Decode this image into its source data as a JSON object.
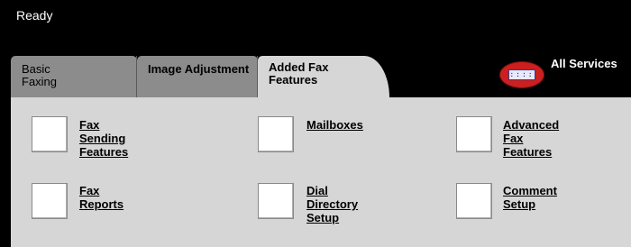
{
  "status_bar": {
    "text": "Ready"
  },
  "tabs": [
    {
      "label": "Basic\nFaxing",
      "active": false
    },
    {
      "label": "Image Adjustment",
      "active": false
    },
    {
      "label": "Added Fax\nFeatures",
      "active": true
    }
  ],
  "all_services": {
    "label": "All Services",
    "icon": "all-services-icon",
    "icon_glyphs": "::::"
  },
  "features": [
    {
      "label": "Fax Sending Features"
    },
    {
      "label": "Mailboxes"
    },
    {
      "label": "Advanced Fax \nFeatures"
    },
    {
      "label": "Fax Reports"
    },
    {
      "label": "Dial Directory Setup"
    },
    {
      "label": "Comment Setup"
    }
  ],
  "colors": {
    "background": "#000000",
    "panel": "#d6d6d6",
    "inactive_tab": "#8c8c8c",
    "all_services_icon": "#cc1f1f"
  }
}
